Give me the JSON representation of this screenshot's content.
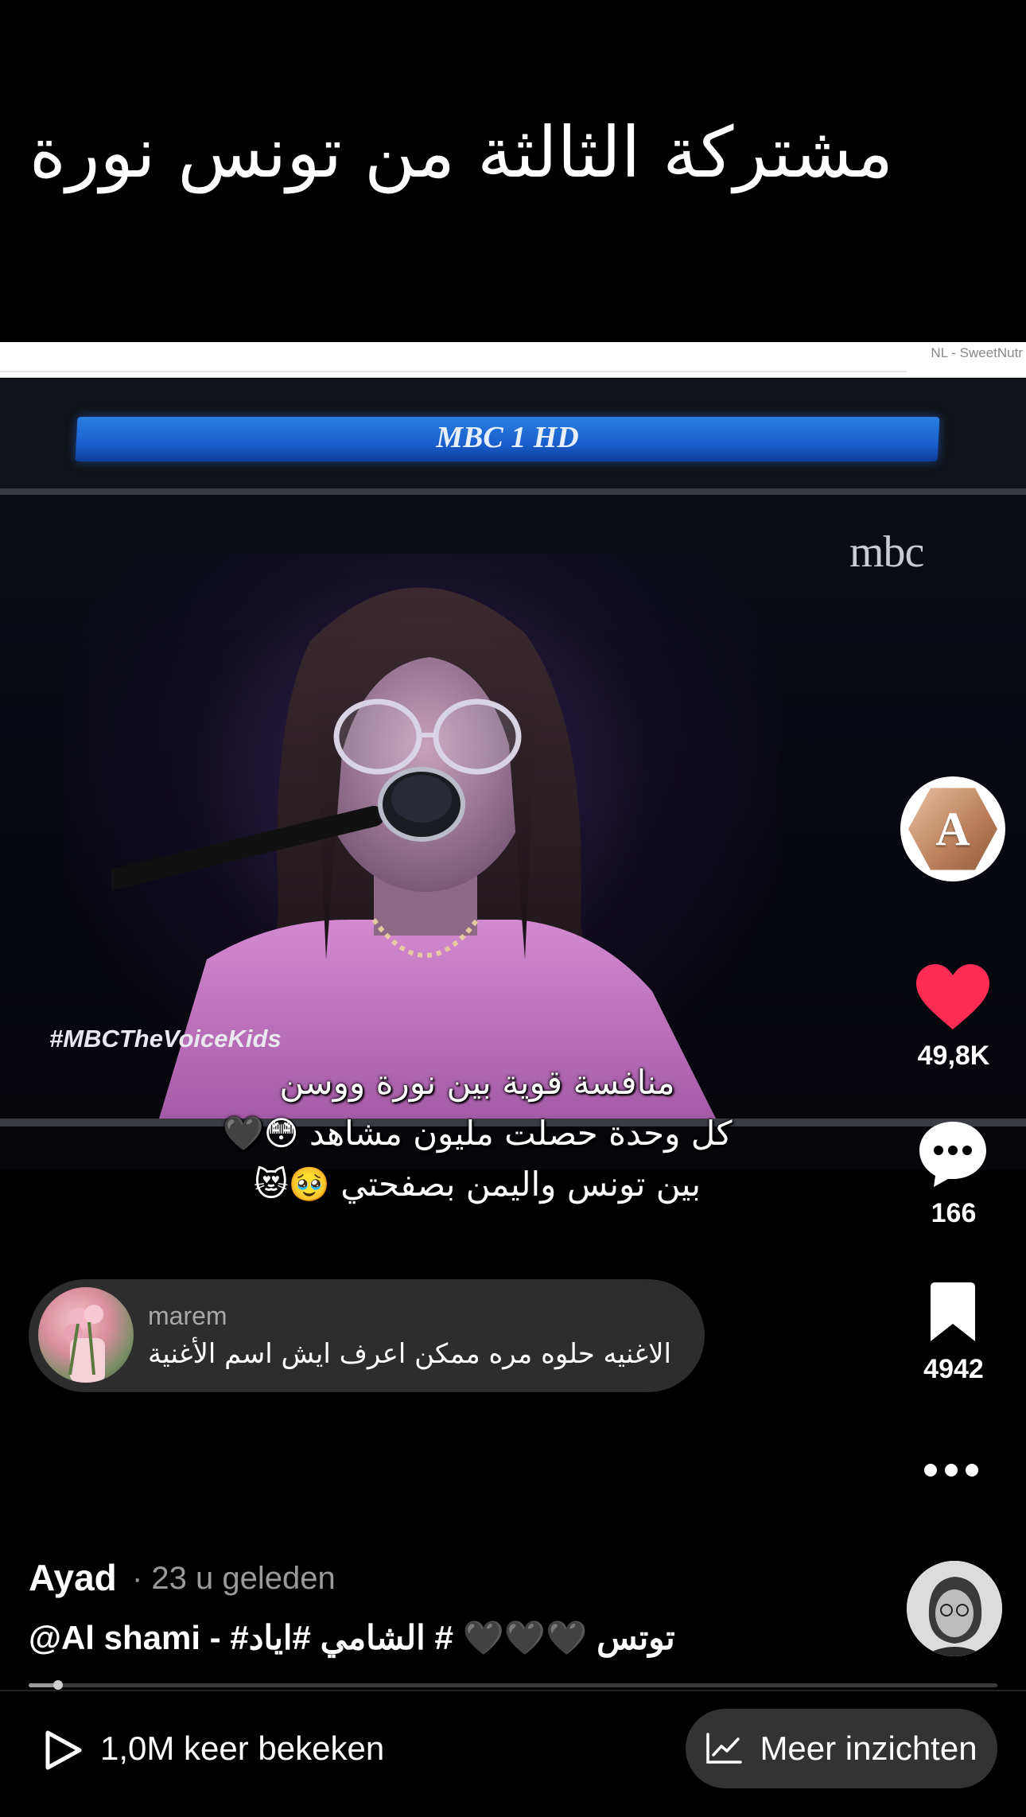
{
  "overlay": {
    "top_title": "مشتركة الثالثة من تونس نورة",
    "captions": [
      "منافسة قوية بين نورة ووسن",
      "كل وحدة حصلت مليون مشاهد 😳🖤",
      "بين تونس واليمن  بصفحتي 🥹😻"
    ]
  },
  "video": {
    "browser_tab_label": "NL - SweetNutr",
    "channel_banner": "MBC 1 HD",
    "channel_logo": "mbc",
    "hashtag_watermark": "#MBCTheVoiceKids"
  },
  "actions": {
    "creator_avatar_letter": "A",
    "likes": "49,8K",
    "comments": "166",
    "bookmarks": "4942",
    "like_color": "#fe2c55"
  },
  "comment_preview": {
    "username": "marem",
    "text": "الاغنيه حلوه مره ممكن اعرف ايش اسم الأغنية"
  },
  "post": {
    "author": "Ayad",
    "time": "· 23 u geleden",
    "description": "@Al shami - #توتس 🖤🖤🖤 # الشامي #اياد",
    "progress": 0.03
  },
  "bottom_bar": {
    "views": "1,0M keer bekeken",
    "insights_label": "Meer inzichten"
  }
}
